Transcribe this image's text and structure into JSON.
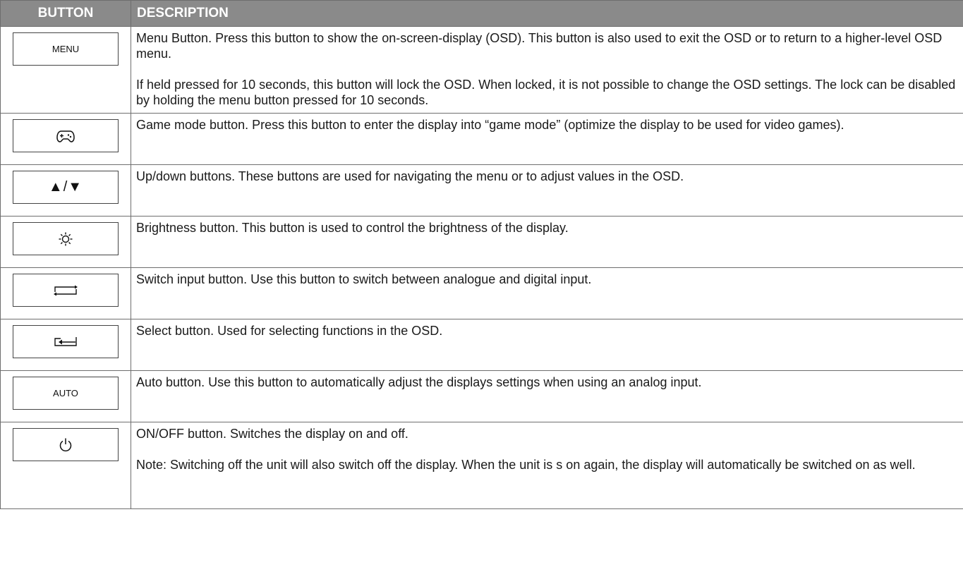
{
  "table": {
    "headers": {
      "button": "BUTTON",
      "description": "DESCRIPTION"
    },
    "rows": [
      {
        "key_label": "MENU",
        "icon": "menu-text",
        "paragraphs": [
          "Menu Button. Press this button to show the on-screen-display (OSD). This button is also used to exit the OSD or to return to a higher-level OSD menu.",
          "If held pressed for 10 seconds, this button will lock the OSD. When locked, it is not possible to change the OSD settings. The lock can be disabled by holding the menu button pressed for 10 seconds."
        ]
      },
      {
        "key_label": "",
        "icon": "gamepad-icon",
        "paragraphs": [
          "Game mode button. Press this button to enter the display into “game mode” (optimize the display to be used for video games)."
        ]
      },
      {
        "key_label": "▲/▼",
        "icon": "up-down-arrows-icon",
        "paragraphs": [
          "Up/down buttons. These buttons are used for navigating the menu or to adjust values in the OSD."
        ]
      },
      {
        "key_label": "",
        "icon": "brightness-icon",
        "paragraphs": [
          "Brightness button. This button is used to control the brightness of the display."
        ]
      },
      {
        "key_label": "",
        "icon": "switch-input-icon",
        "paragraphs": [
          "Switch input button. Use this button to switch between analogue and digital input."
        ]
      },
      {
        "key_label": "",
        "icon": "select-enter-icon",
        "paragraphs": [
          "Select button. Used for selecting functions in the OSD."
        ]
      },
      {
        "key_label": "AUTO",
        "icon": "auto-text",
        "paragraphs": [
          "Auto button. Use this button to automatically adjust the displays settings when using an analog input."
        ]
      },
      {
        "key_label": "",
        "icon": "power-icon",
        "paragraphs": [
          "ON/OFF button. Switches the display on and off.",
          "Note:  Switching off the unit will also switch off the display. When the unit is s on again, the display will automatically be switched on as well."
        ]
      }
    ]
  }
}
